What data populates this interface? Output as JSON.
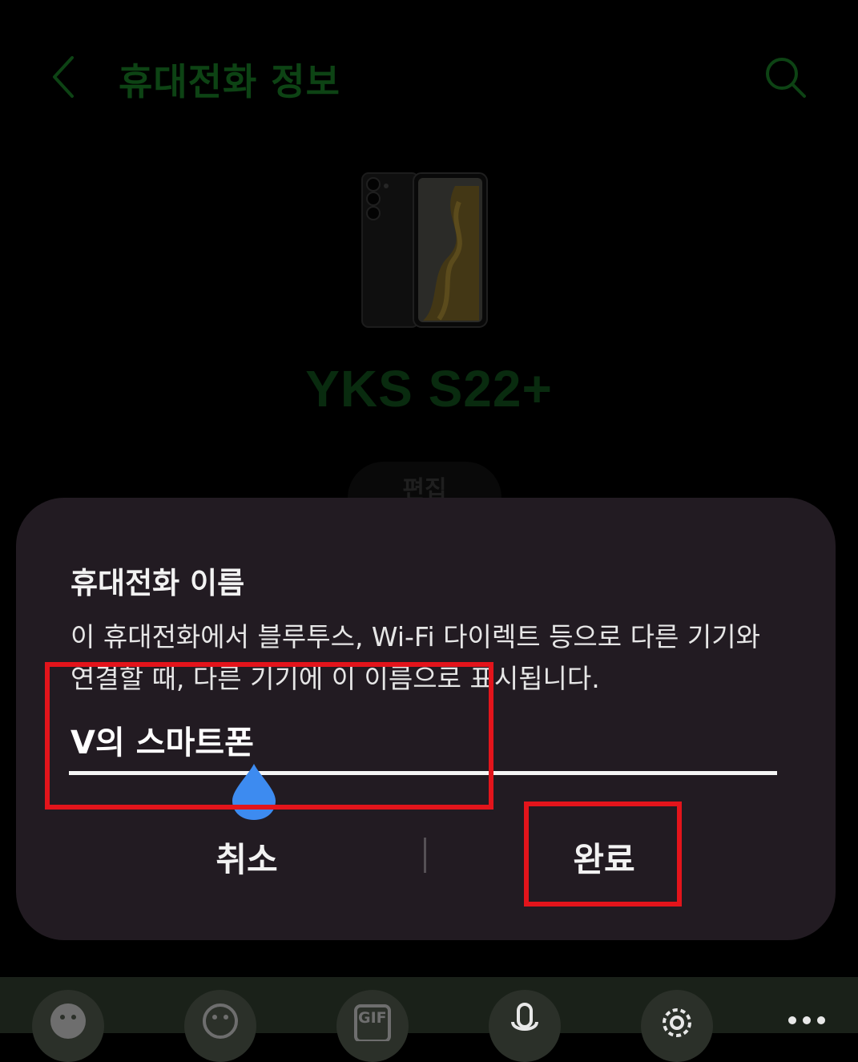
{
  "header": {
    "title": "휴대전화 정보",
    "back_icon": "chevron-left-icon",
    "search_icon": "search-icon"
  },
  "device": {
    "name": "YKS S22+",
    "edit_label": "편집"
  },
  "dialog": {
    "title": "휴대전화 이름",
    "description": "이 휴대전화에서 블루투스, Wi-Fi 다이렉트 등으로 다른 기기와 연결할 때, 다른 기기에 이 이름으로 표시됩니다.",
    "input_value": "V의 스마트폰",
    "cancel_label": "취소",
    "done_label": "완료"
  },
  "keyboard_toolbar": {
    "items": [
      "sticker-icon",
      "emoji-icon",
      "gif-icon",
      "microphone-icon",
      "gear-icon",
      "more-icon"
    ],
    "gif_label": "GIF"
  },
  "colors": {
    "accent_green": "#125a1b",
    "dialog_bg": "#221b22",
    "cursor_handle": "#3d8bf0",
    "annotation_red": "#e3141b"
  }
}
